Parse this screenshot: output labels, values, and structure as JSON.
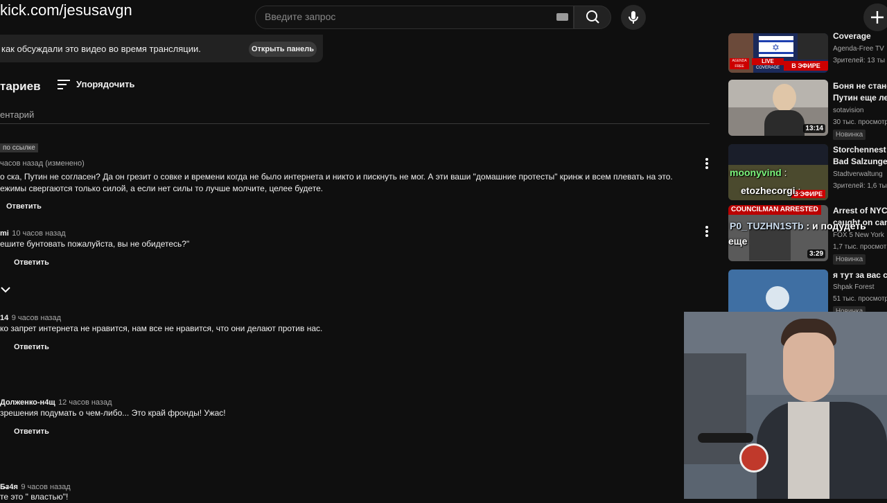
{
  "overlay": {
    "watermark": "kick.com/jesusavgn"
  },
  "topbar": {
    "search_placeholder": "Введите запрос"
  },
  "chat_banner": {
    "text": "как обсуждали это видео во время трансляции.",
    "button": "Открыть панель"
  },
  "comments": {
    "count_label": "тариев",
    "sort_label": "Упорядочить",
    "add_placeholder": "ентарий",
    "pinned_badge": "по ссылке",
    "items": [
      {
        "meta": "часов назад (изменено)",
        "line1": "о ска, Путин не согласен? Да он грезит о совке и времени когда не было интернета и никто и пискнуть не мог. А эти ваши \"домашние протесты\" кринж и всем плевать на это.",
        "line2": "ежимы свергаются только силой, а если нет силы то лучше молчите, целее будете.",
        "reply": "Ответить"
      },
      {
        "author": "mi",
        "time": "10 часов назад",
        "line1": "ешите бунтовать пожалуйста, вы не обидетесь?\"",
        "reply": "Ответить"
      },
      {
        "author": "14",
        "time": "9 часов назад",
        "line1": "ко запрет интернета не нравится, нам все не нравится, что  они делают против нас.",
        "reply": "Ответить"
      },
      {
        "author": "Долженко-н4щ",
        "time": "12 часов назад",
        "line1": "зрешения подумать о чем-либо... Это край фронды! Ужас!",
        "reply": "Ответить"
      },
      {
        "author": "Б̶з4я",
        "time": "9 часов назад",
        "line1": "те это \" властью\"!"
      }
    ]
  },
  "sidebar": {
    "videos": [
      {
        "title1": "Coverage",
        "channel": "Agenda-Free TV",
        "views": "Зрителей: 13 ты",
        "thumb_live": "LIVE",
        "thumb_live2": "В ЭФИРЕ",
        "thumb_tag": "AGENDA FREE",
        "thumb_sub": "COVERAGE"
      },
      {
        "title1": "Боня не стане",
        "title2": "Путин еще лет",
        "channel": "sotavision",
        "views": "30 тыс. просмотр",
        "duration": "13:14",
        "badge": "Новинка"
      },
      {
        "title1": "Storchennest B",
        "title2": "Bad Salzunger",
        "channel": "Stadtverwaltung",
        "views": "Зрителей: 1,6 ты",
        "thumb_live": "В ЭФИРЕ"
      },
      {
        "title1": "Arrest of NYC C",
        "title2": "caught on cam",
        "channel": "FOX 5 New York",
        "views": "1,7 тыс. просмотр",
        "duration": "3:29",
        "badge": "Новинка",
        "thumb_banner": "COUNCILMAN ARRESTED"
      },
      {
        "title1": "я тут за вас су",
        "channel": "Shpak Forest",
        "views": "51 тыс. просмотр",
        "badge": "Новинка"
      }
    ]
  },
  "stream_chat": [
    {
      "user": "moonyvind",
      "text": ":"
    },
    {
      "user": "etozhecorgi",
      "text": ":"
    },
    {
      "user": "P0_TUZHN1STb",
      "text": ": и подудеть",
      "text2": "еще"
    }
  ],
  "colors": {
    "bg": "#0f0f0f",
    "live_red": "#cc0000",
    "chat_green": "#7cf57c"
  }
}
